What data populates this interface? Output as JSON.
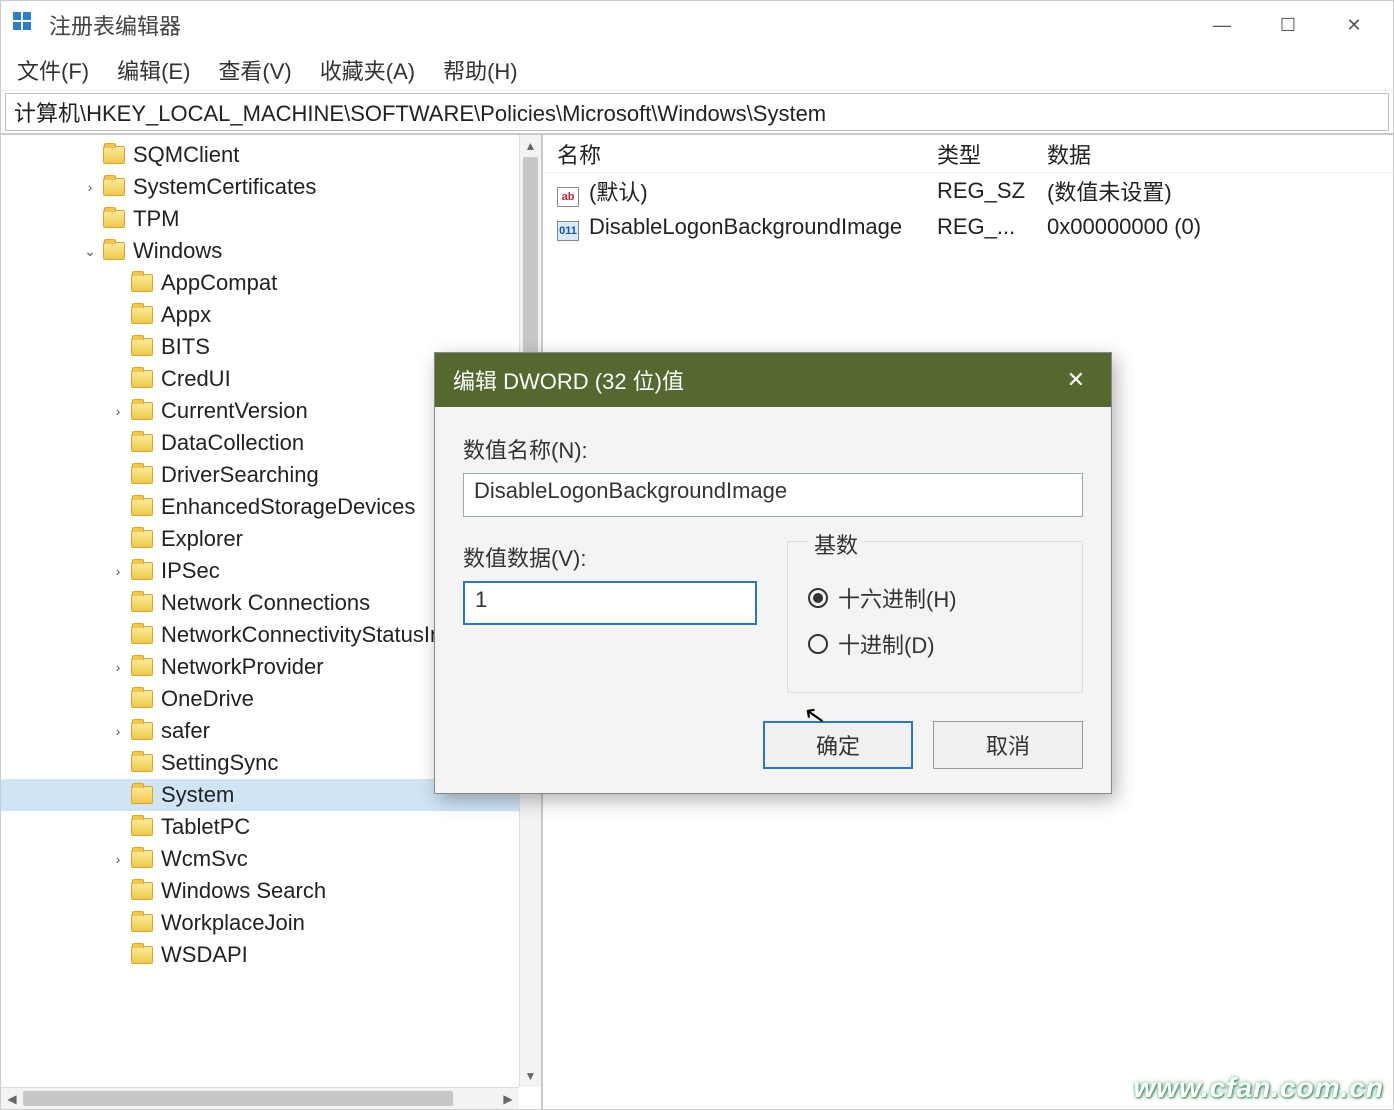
{
  "window": {
    "title": "注册表编辑器"
  },
  "winicons": {
    "min": "—",
    "max": "☐",
    "close": "✕"
  },
  "menu": {
    "file": "文件(F)",
    "edit": "编辑(E)",
    "view": "查看(V)",
    "fav": "收藏夹(A)",
    "help": "帮助(H)"
  },
  "address": "计算机\\HKEY_LOCAL_MACHINE\\SOFTWARE\\Policies\\Microsoft\\Windows\\System",
  "tree": {
    "items": [
      {
        "label": "SQMClient",
        "indent": 3,
        "expander": ""
      },
      {
        "label": "SystemCertificates",
        "indent": 3,
        "expander": ">"
      },
      {
        "label": "TPM",
        "indent": 3,
        "expander": ""
      },
      {
        "label": "Windows",
        "indent": 3,
        "expander": "v"
      },
      {
        "label": "AppCompat",
        "indent": 4,
        "expander": ""
      },
      {
        "label": "Appx",
        "indent": 4,
        "expander": ""
      },
      {
        "label": "BITS",
        "indent": 4,
        "expander": ""
      },
      {
        "label": "CredUI",
        "indent": 4,
        "expander": ""
      },
      {
        "label": "CurrentVersion",
        "indent": 4,
        "expander": ">"
      },
      {
        "label": "DataCollection",
        "indent": 4,
        "expander": ""
      },
      {
        "label": "DriverSearching",
        "indent": 4,
        "expander": ""
      },
      {
        "label": "EnhancedStorageDevices",
        "indent": 4,
        "expander": ""
      },
      {
        "label": "Explorer",
        "indent": 4,
        "expander": ""
      },
      {
        "label": "IPSec",
        "indent": 4,
        "expander": ">"
      },
      {
        "label": "Network Connections",
        "indent": 4,
        "expander": ""
      },
      {
        "label": "NetworkConnectivityStatusIn",
        "indent": 4,
        "expander": ""
      },
      {
        "label": "NetworkProvider",
        "indent": 4,
        "expander": ">"
      },
      {
        "label": "OneDrive",
        "indent": 4,
        "expander": ""
      },
      {
        "label": "safer",
        "indent": 4,
        "expander": ">"
      },
      {
        "label": "SettingSync",
        "indent": 4,
        "expander": ""
      },
      {
        "label": "System",
        "indent": 4,
        "expander": "",
        "selected": true
      },
      {
        "label": "TabletPC",
        "indent": 4,
        "expander": ""
      },
      {
        "label": "WcmSvc",
        "indent": 4,
        "expander": ">"
      },
      {
        "label": "Windows Search",
        "indent": 4,
        "expander": ""
      },
      {
        "label": "WorkplaceJoin",
        "indent": 4,
        "expander": ""
      },
      {
        "label": "WSDAPI",
        "indent": 4,
        "expander": ""
      }
    ]
  },
  "list": {
    "headers": {
      "name": "名称",
      "type": "类型",
      "data": "数据"
    },
    "rows": [
      {
        "icon": "ab",
        "name": "(默认)",
        "type": "REG_SZ",
        "data": "(数值未设置)"
      },
      {
        "icon": "011",
        "name": "DisableLogonBackgroundImage",
        "type": "REG_...",
        "data": "0x00000000 (0)"
      }
    ]
  },
  "dialog": {
    "title": "编辑 DWORD (32 位)值",
    "name_label": "数值名称(N):",
    "name_value": "DisableLogonBackgroundImage",
    "data_label": "数值数据(V):",
    "data_value": "1",
    "base_label": "基数",
    "hex_label": "十六进制(H)",
    "dec_label": "十进制(D)",
    "ok": "确定",
    "cancel": "取消"
  },
  "watermark": "www.cfan.com.cn"
}
